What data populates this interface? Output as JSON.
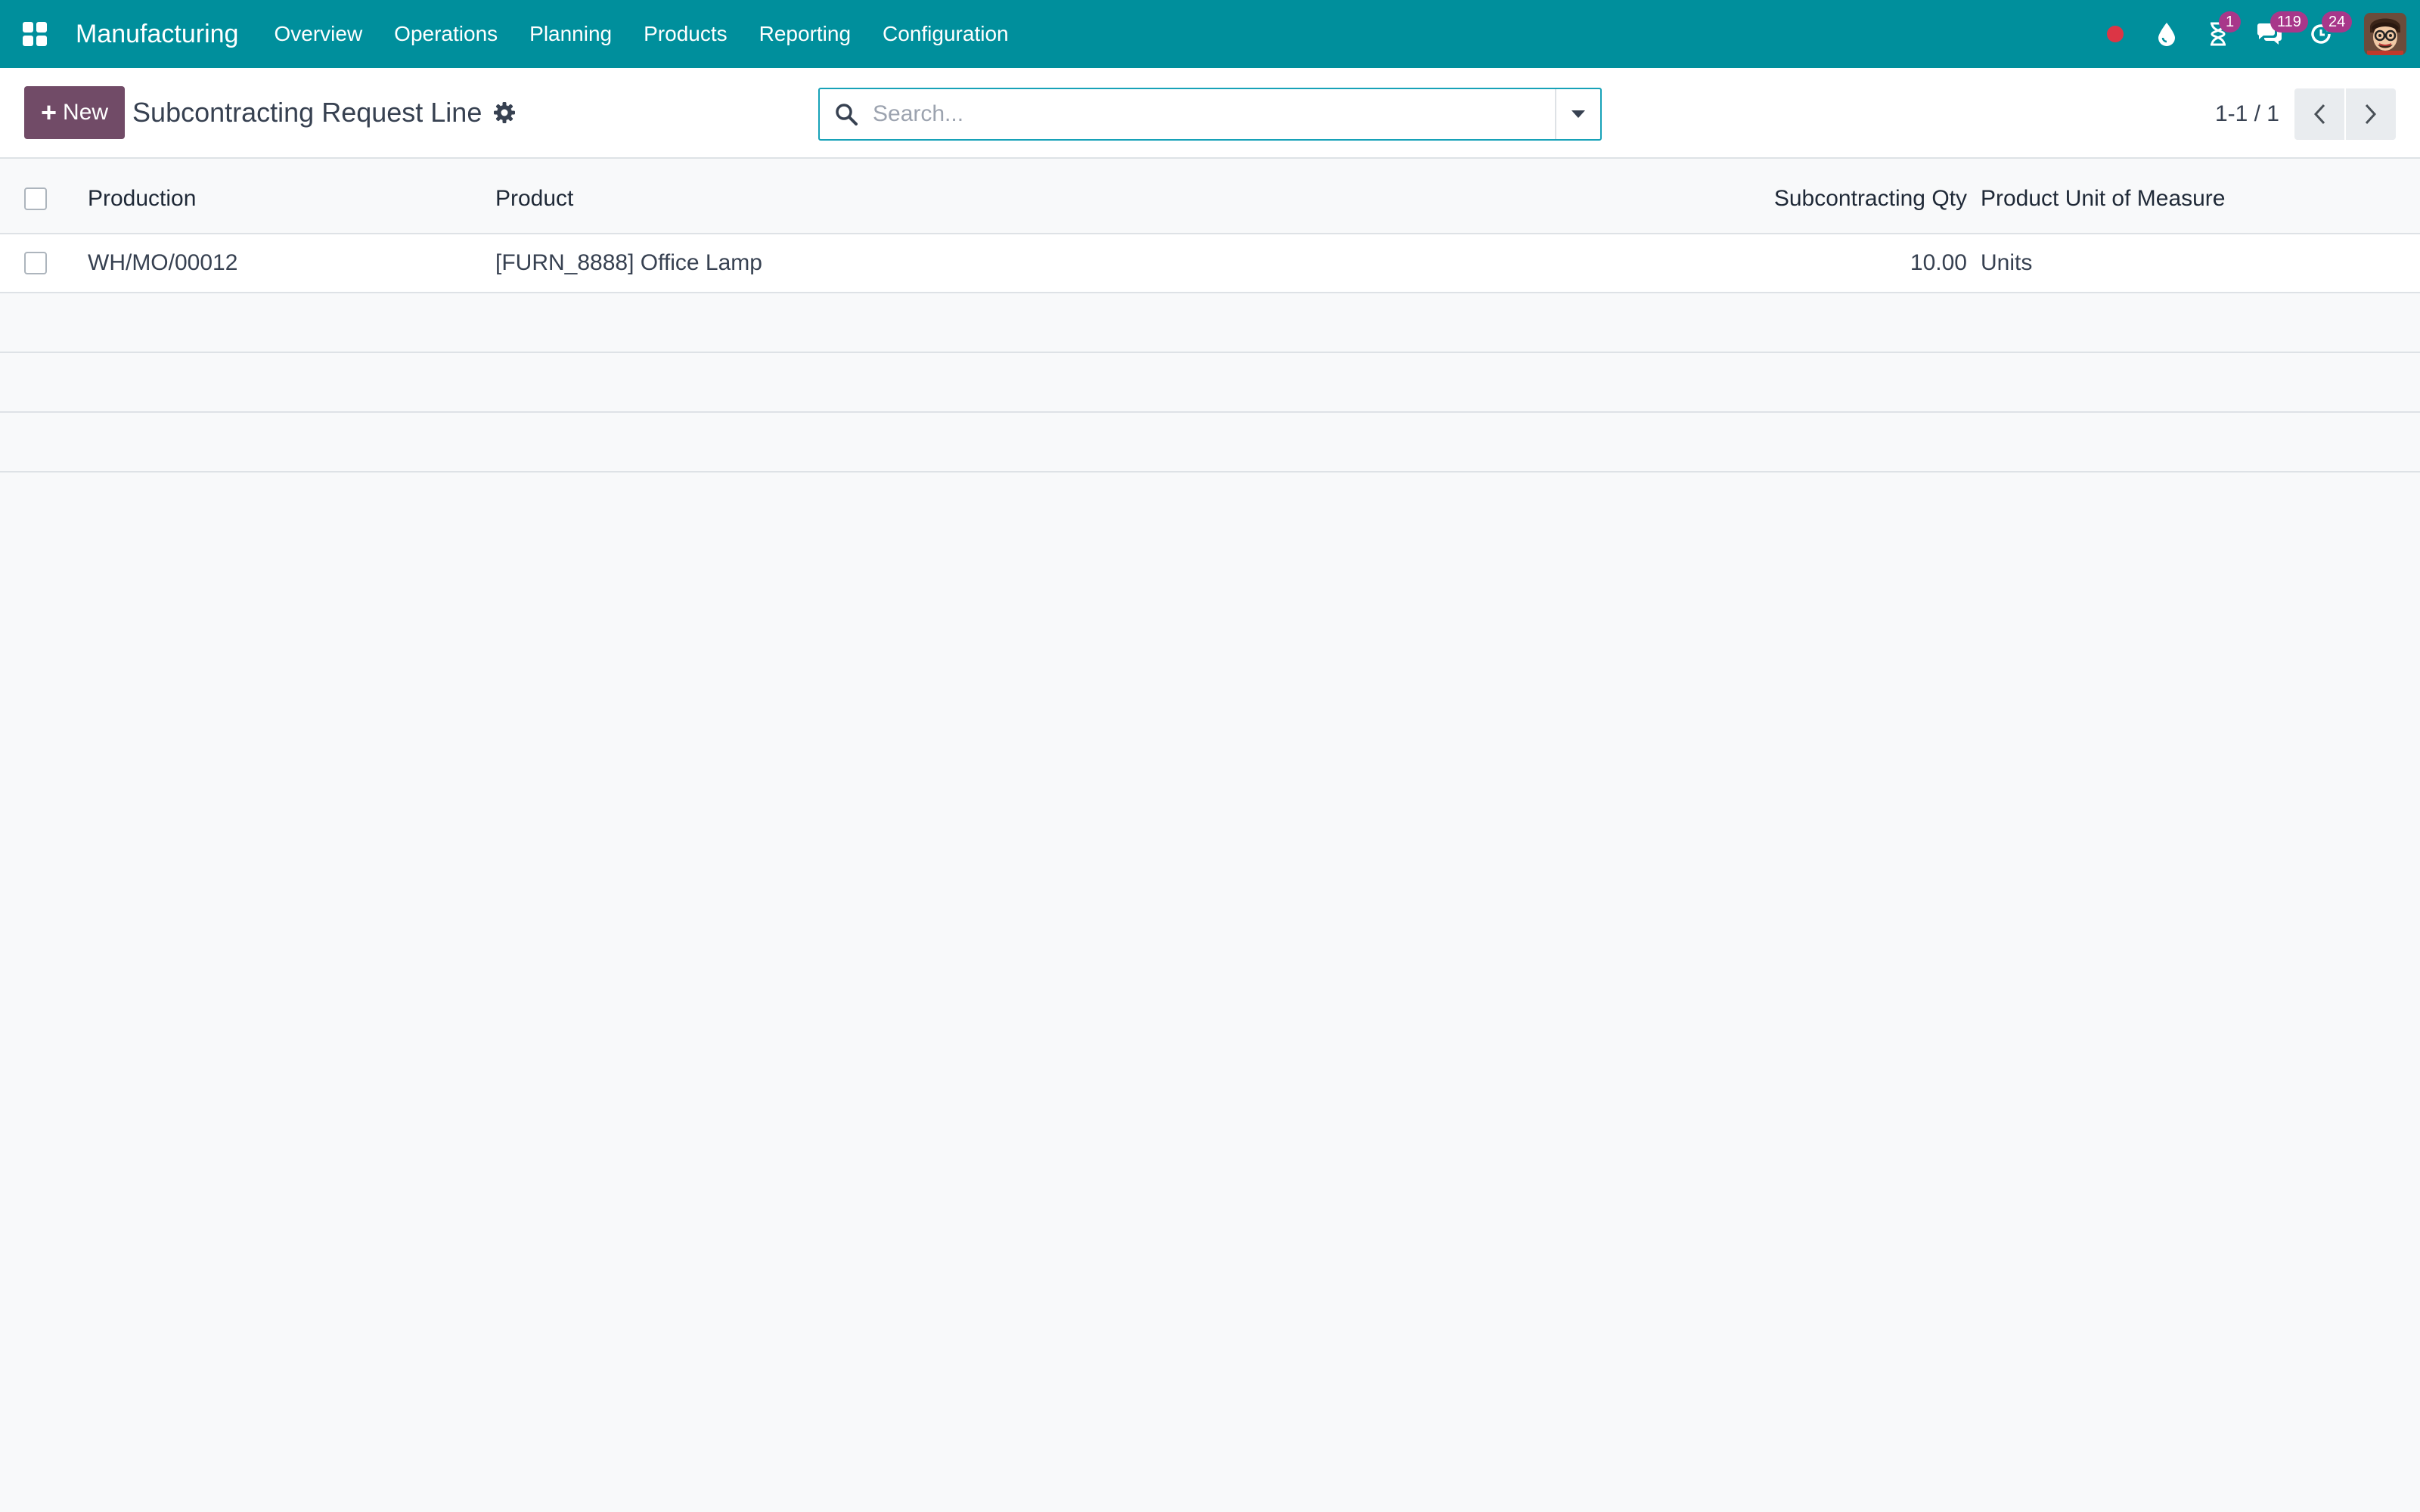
{
  "navbar": {
    "app_name": "Manufacturing",
    "menu": [
      "Overview",
      "Operations",
      "Planning",
      "Products",
      "Reporting",
      "Configuration"
    ],
    "badges": {
      "activities": "1",
      "messages": "119",
      "updates": "24"
    }
  },
  "control_panel": {
    "new_label": "New",
    "title": "Subcontracting Request Line",
    "search_placeholder": "Search...",
    "pager": "1-1 / 1"
  },
  "list": {
    "columns": {
      "production": "Production",
      "product": "Product",
      "qty": "Subcontracting Qty",
      "uom": "Product Unit of Measure"
    },
    "rows": [
      {
        "production": "WH/MO/00012",
        "product": "[FURN_8888] Office Lamp",
        "qty": "10.00",
        "uom": "Units"
      }
    ]
  },
  "colors": {
    "navbar": "#008f9c",
    "primary": "#714b67",
    "badge": "#a8378a",
    "recording_dot": "#dc3545"
  }
}
